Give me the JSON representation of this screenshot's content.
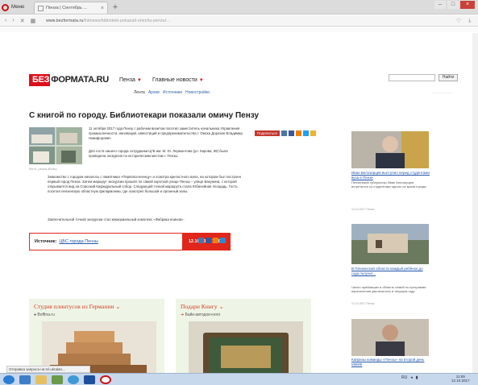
{
  "browser": {
    "menu_label": "Меню",
    "tab_title": "Пенза | Сентябрь ...",
    "url_domain": "www.bezformata.ru",
    "url_path": "/listnews/biblioteki-pokazali-omichu-penzu/..."
  },
  "site": {
    "logo_red": "БЕЗ",
    "logo_text": "ФОРМАТА.RU",
    "city": "Пенза",
    "news_nav": "Главные новости",
    "subnav": [
      "Лента",
      "Архив",
      "Источники",
      "Новостройки"
    ],
    "search_button": "Найти"
  },
  "article": {
    "headline": "С книгой по городу. Библиотекари показали омичу Пензу",
    "photo_caption": "Фото: penza-library",
    "para1": "11 октября 2017 года Пензу с рабочим визитом посетил заместитель начальника Управления промышленности, инноваций, инвестиций и предпринимательства г. Омска Дорохин Владимир Никифорович.",
    "para2": "Для гостя нашего города сотрудники ЦГБ им. М. Ю. Лермонтова (ул. Кирова, 69) была проведена экскурсия по историческим местам г. Пензы.",
    "para3": "Знакомство с городом началось с памятника «Первопоселенцу» и осмотра крепостного вала, на котором был построен первый город Пенза. Затем маршрут экскурсии прошёл по самой короткой улице Пензы – улице Бакунина, с которой открывается вид на Спасский Кафедральный собор. Следующей точкой маршрута стала Юбилейная площадь. Гость посетил пензенскую областную филармонию, где осмотрел большой и органный залы.",
    "para4": "Заключительной точкой экскурсии стал мемориальный комплекс «Фабрика воинов».",
    "share_label": "Поделиться",
    "source_label": "Источник:",
    "source_name": "ЦБС города Пензы",
    "source_date": "12.10.2017  16:08"
  },
  "cards": [
    {
      "title": "Студия плинтусов из Германии",
      "subtitle": "Boffina.ru"
    },
    {
      "title": "Подари Книгу",
      "subtitle": "Байк-автодок»ного"
    }
  ],
  "sidebar": [
    {
      "link": "Иван Белозерцев выступил перед студентами вуза в Пензе",
      "text": "Пензенский губернатор Иван Белозерцев встретился со студентами одного из вузов города.",
      "date": "12.10.2017 Пенза"
    },
    {
      "link": "В Пензенской области каждый ребёнок до года получит...",
      "text": "Число прибывших в область семей по программе переселения увеличилось в текущем году.",
      "date": "12.10.2017 Пенза"
    },
    {
      "link": "Капризы команды «Пензы» на второй день ММКФ",
      "text": "",
      "date": ""
    }
  ],
  "status": {
    "tip": "Отправка запроса на tcl.ukralan..."
  },
  "taskbar": {
    "clock_time": "11:59",
    "clock_date": "12.10.2017",
    "lang": "RU"
  },
  "colors": {
    "brand_red": "#d9111b",
    "card_bg": "#eef5e6",
    "link_blue": "#2255aa"
  }
}
